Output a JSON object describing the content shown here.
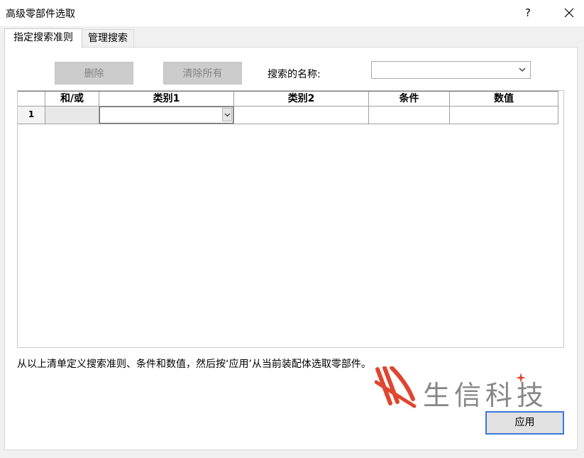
{
  "window": {
    "title": "高级零部件选取",
    "help_label": "?"
  },
  "tabs": [
    {
      "label": "指定搜索准则",
      "active": true
    },
    {
      "label": "管理搜索",
      "active": false
    }
  ],
  "toolbar": {
    "delete_label": "删除",
    "clear_all_label": "清除所有",
    "search_name_label": "搜索的名称:",
    "search_name_value": ""
  },
  "grid": {
    "headers": [
      "",
      "和/或",
      "类别1",
      "类别2",
      "条件",
      "数值"
    ],
    "rows": [
      {
        "num": "1",
        "andor": "",
        "category1": "",
        "category2": "",
        "condition": "",
        "value": ""
      }
    ]
  },
  "instruction": "从以上清单定义搜索准则、条件和数值，然后按‘应用’从当前装配体选取零部件。",
  "watermark": {
    "text": "生信科技"
  },
  "apply_label": "应用",
  "colors": {
    "accent": "#3b78d7",
    "disabled_button": "#cccccc",
    "watermark_red": "#e0462f",
    "watermark_gray": "#878787"
  }
}
